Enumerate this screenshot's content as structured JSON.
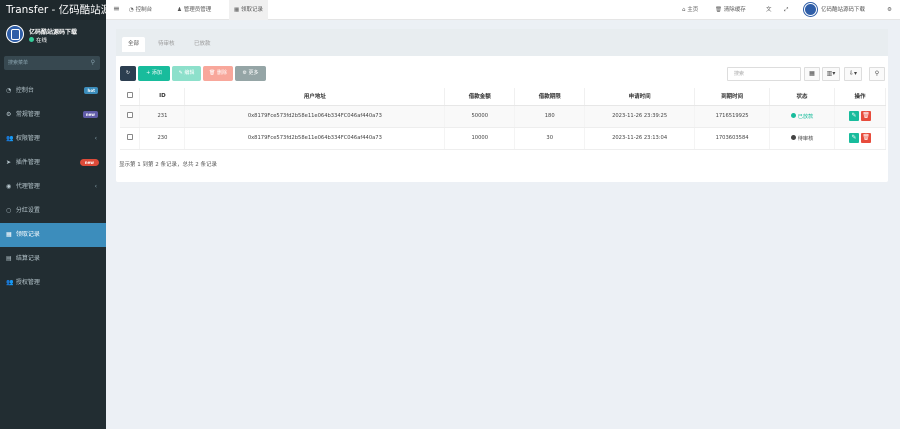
{
  "app": {
    "title": "Transfer - 亿码酷站源"
  },
  "user": {
    "name": "亿码酷站源码下载",
    "status": "在线"
  },
  "sidebar": {
    "search_placeholder": "搜索菜单",
    "items": [
      {
        "label": "控制台",
        "icon": "dashboard-icon",
        "badge": "hot",
        "badge_color": "#3c8dbc"
      },
      {
        "label": "常规管理",
        "icon": "cogs-icon",
        "badge": "new",
        "badge_color": "#605ca8"
      },
      {
        "label": "权限管理",
        "icon": "group-icon",
        "has_children": true
      },
      {
        "label": "插件管理",
        "icon": "rocket-icon",
        "badge": "new",
        "badge_color": "#dd4b39"
      },
      {
        "label": "代理管理",
        "icon": "user-circle-icon",
        "has_children": true
      },
      {
        "label": "分红设置",
        "icon": "circle-icon"
      },
      {
        "label": "领取记录",
        "icon": "list-icon",
        "active": true
      },
      {
        "label": "结算记录",
        "icon": "table-icon"
      },
      {
        "label": "授权管理",
        "icon": "group-icon"
      }
    ]
  },
  "topnav": {
    "tabs": [
      "控制台",
      "管理员管理",
      "领取记录"
    ],
    "home": "主页",
    "clear_cache": "清除缓存",
    "lang": "🌐",
    "fullscreen": "⛶",
    "user_name": "亿码酷站源码下载"
  },
  "content": {
    "tabs": [
      "全部",
      "待审核",
      "已放款"
    ],
    "toolbar": {
      "refresh": "↻",
      "add": "+ 添加",
      "edit": "✎ 编辑",
      "delete": "🗑 删除",
      "more": "⚙ 更多"
    },
    "search_placeholder": "搜索",
    "table": {
      "headers": [
        "ID",
        "用户地址",
        "借款金额",
        "借款期限",
        "申请时间",
        "到期时间",
        "状态",
        "操作"
      ],
      "rows": [
        {
          "id": "231",
          "address": "0x8179Fce573fd2b58e11e064b334FC046af440a73",
          "amount": "50000",
          "term": "180",
          "apply_time": "2023-11-26 23:39:25",
          "expire_time": "1716519925",
          "status": "已放款",
          "status_color": "#18bc9c"
        },
        {
          "id": "230",
          "address": "0x8179Fce573fd2b58e11e064b334FC046af440a73",
          "amount": "10000",
          "term": "30",
          "apply_time": "2023-11-26 23:13:04",
          "expire_time": "1703603584",
          "status": "待审核",
          "status_color": "#444444"
        }
      ]
    },
    "footer": "显示第 1 到第 2 条记录，总共 2 条记录"
  }
}
